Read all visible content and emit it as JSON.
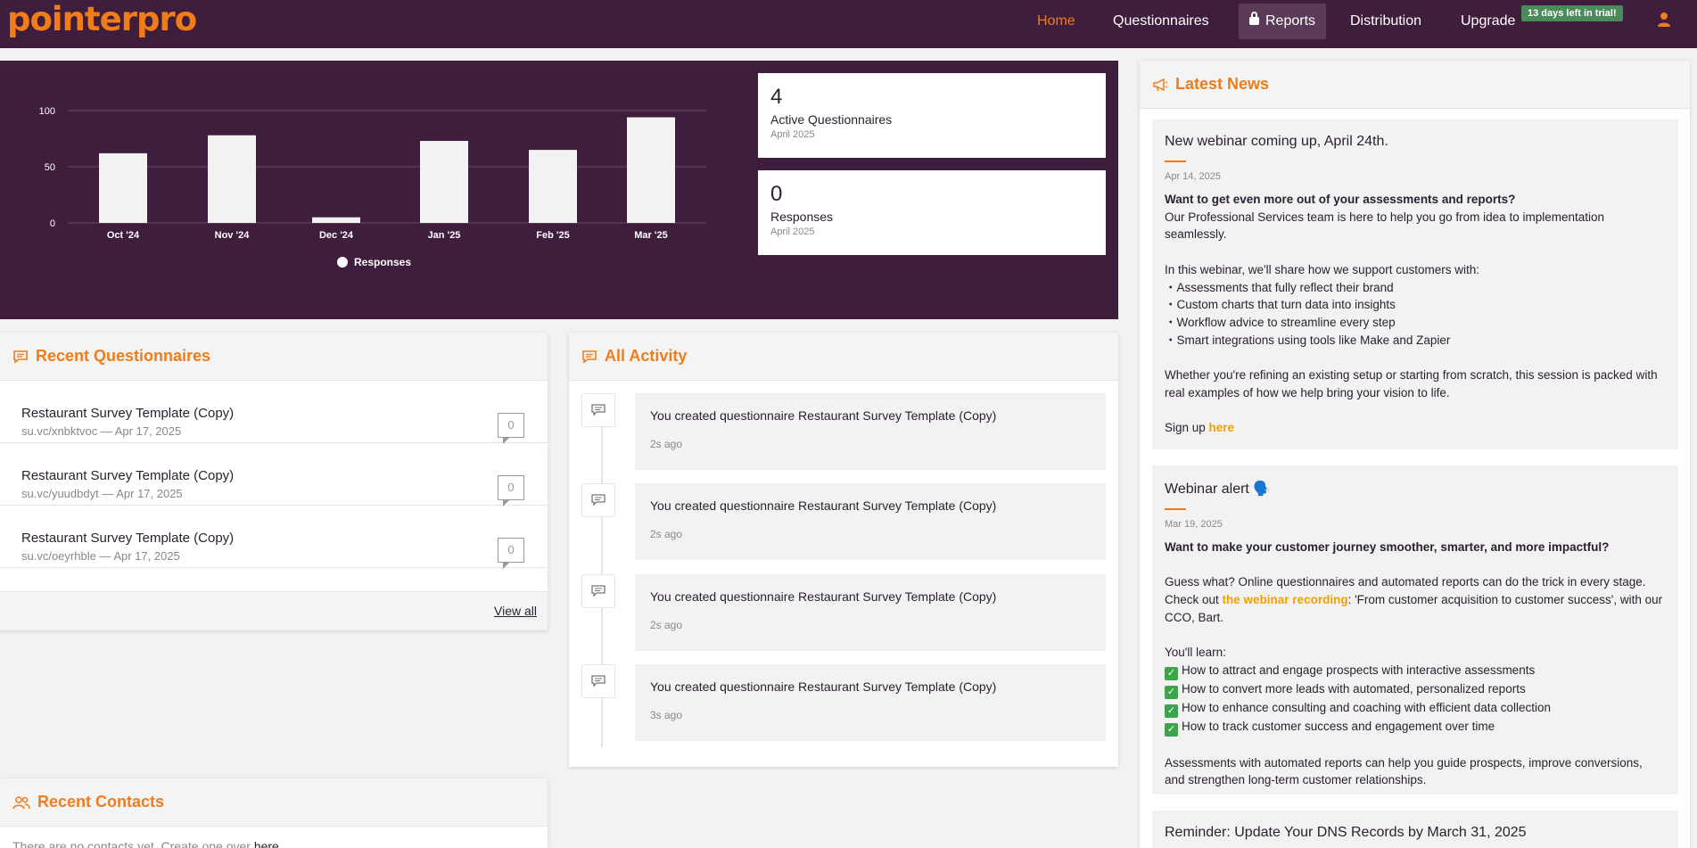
{
  "nav": {
    "logo": "pointerpro",
    "items": [
      "Home",
      "Questionnaires",
      "Reports",
      "Distribution",
      "Upgrade"
    ],
    "trial_badge": "13 days left in trial!",
    "active": "Home"
  },
  "chart_data": {
    "type": "bar",
    "categories": [
      "Oct '24",
      "Nov '24",
      "Dec '24",
      "Jan '25",
      "Feb '25",
      "Mar '25"
    ],
    "series": [
      {
        "name": "Responses",
        "values": [
          62,
          78,
          5,
          73,
          65,
          94
        ]
      }
    ],
    "y_ticks": [
      "0",
      "50",
      "100"
    ],
    "ylim": [
      0,
      100
    ],
    "grid": true,
    "legend": "bottom"
  },
  "stats": [
    {
      "value": "4",
      "label": "Active Questionnaires",
      "period": "April 2025"
    },
    {
      "value": "0",
      "label": "Responses",
      "period": "April 2025"
    }
  ],
  "recent_questionnaires": {
    "title": "Recent Questionnaires",
    "items": [
      {
        "title": "Restaurant Survey Template (Copy)",
        "meta": "su.vc/xnbktvoc — Apr 17, 2025",
        "count": "0"
      },
      {
        "title": "Restaurant Survey Template (Copy)",
        "meta": "su.vc/yuudbdyt — Apr 17, 2025",
        "count": "0"
      },
      {
        "title": "Restaurant Survey Template (Copy)",
        "meta": "su.vc/oeyrhble — Apr 17, 2025",
        "count": "0"
      }
    ],
    "view_all": "View all"
  },
  "activity": {
    "title": "All Activity",
    "items": [
      {
        "text": "You created questionnaire Restaurant Survey Template (Copy)",
        "time": "2s ago"
      },
      {
        "text": "You created questionnaire Restaurant Survey Template (Copy)",
        "time": "2s ago"
      },
      {
        "text": "You created questionnaire Restaurant Survey Template (Copy)",
        "time": "2s ago"
      },
      {
        "text": "You created questionnaire Restaurant Survey Template (Copy)",
        "time": "3s ago"
      }
    ]
  },
  "recent_contacts": {
    "title": "Recent Contacts",
    "empty_text": "There are no contacts yet. Create one over ",
    "empty_link": "here"
  },
  "news": {
    "title": "Latest News",
    "item1": {
      "title": "New webinar coming up, April 24th.",
      "date": "Apr 14, 2025",
      "lead": "Want to get even more out of your assessments and reports?",
      "p1": "Our Professional Services team is here to help you go from idea to implementation seamlessly.",
      "p2": "In this webinar, we'll share how we support customers with:",
      "bullets": [
        "・Assessments that fully reflect their brand",
        "・Custom charts that turn data into insights",
        "・Workflow advice to streamline every step",
        "・Smart integrations using tools like Make and Zapier"
      ],
      "p3": "Whether you're refining an existing setup or starting from scratch, this session is packed with real examples of how we help bring your vision to life.",
      "signup": "Sign up ",
      "signup_link": "here"
    },
    "item2": {
      "title": "Webinar alert",
      "title_emoji": "🗣️",
      "date": "Mar 19, 2025",
      "lead": "Want to make your customer journey smoother, smarter, and more impactful?",
      "p1a": "Guess what? Online questionnaires and automated reports can do the trick in every stage. Check out ",
      "p1_link": "the webinar recording",
      "p1b": ": 'From customer acquisition to customer success', with our CCO, Bart.",
      "learn": "You'll learn:",
      "checks": [
        "How to attract and engage prospects with interactive assessments",
        "How to convert more leads with automated, personalized reports",
        "How to enhance consulting and coaching with efficient data collection",
        "How to track customer success and engagement over time"
      ],
      "p2": "Assessments with automated reports can help you guide prospects, improve conversions, and strengthen long-term customer relationships."
    },
    "item3": {
      "title": "Reminder: Update Your DNS Records by March 31, 2025"
    }
  }
}
